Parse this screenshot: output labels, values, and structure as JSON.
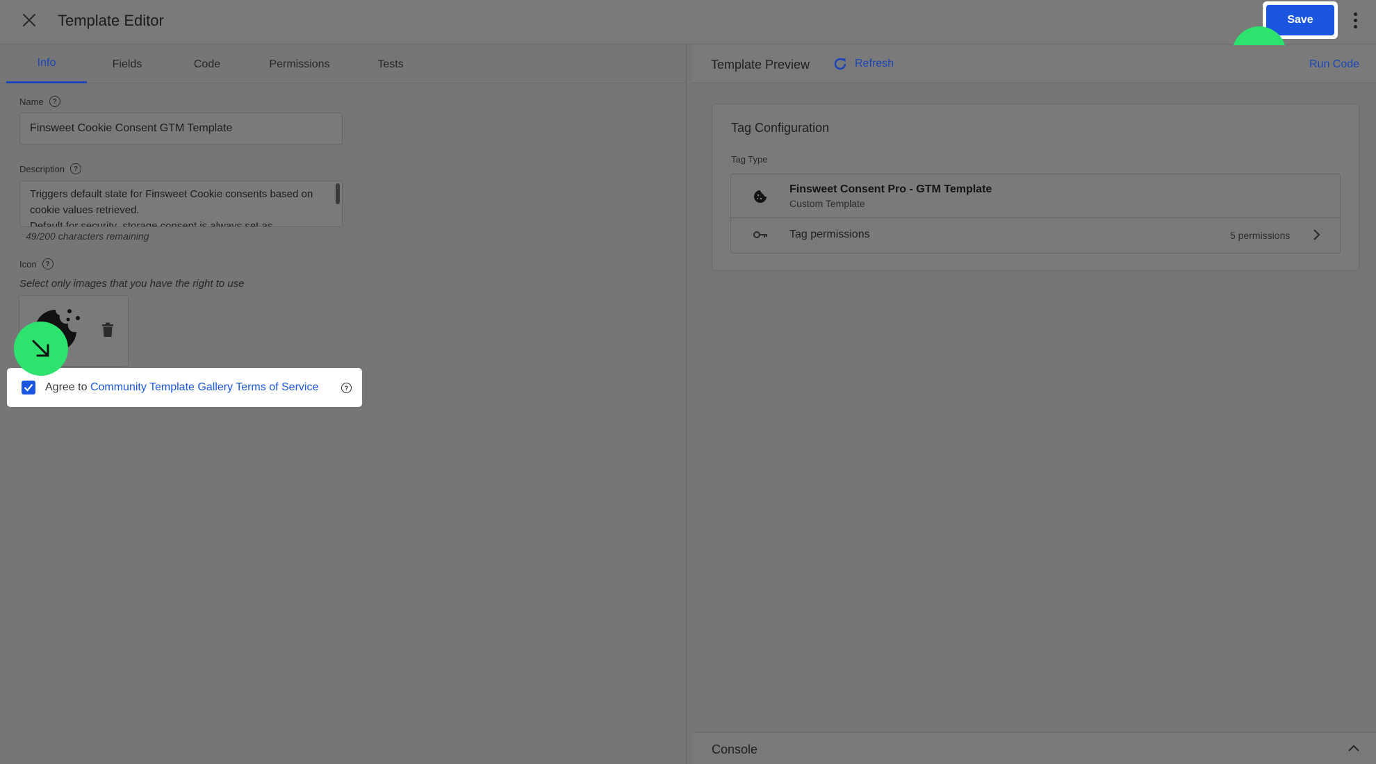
{
  "header": {
    "title": "Template Editor",
    "save_label": "Save"
  },
  "tabs": [
    {
      "label": "Info",
      "active": true
    },
    {
      "label": "Fields"
    },
    {
      "label": "Code"
    },
    {
      "label": "Permissions"
    },
    {
      "label": "Tests"
    }
  ],
  "info": {
    "name_label": "Name",
    "name_value": "Finsweet Cookie Consent GTM Template",
    "description_label": "Description",
    "description_value": "Triggers default state for Finsweet Cookie consents based on cookie values retrieved.\nDefault for security_storage consent is always set as",
    "chars_remaining": "49/200 characters remaining",
    "icon_label": "Icon",
    "icon_helper": "Select only images that you have the right to use",
    "agree_prefix": "Agree to ",
    "agree_link": "Community Template Gallery Terms of Service",
    "agree_checked": true
  },
  "preview": {
    "title": "Template Preview",
    "refresh_label": "Refresh",
    "run_code_label": "Run Code",
    "card_title": "Tag Configuration",
    "tag_type_label": "Tag Type",
    "tag_name": "Finsweet Consent Pro - GTM Template",
    "tag_subtitle": "Custom Template",
    "permissions_label": "Tag permissions",
    "permissions_count": "5 permissions",
    "console_label": "Console"
  },
  "colors": {
    "accent": "#1a56e0",
    "link": "#1a46b8",
    "marker": "#2de36d"
  }
}
